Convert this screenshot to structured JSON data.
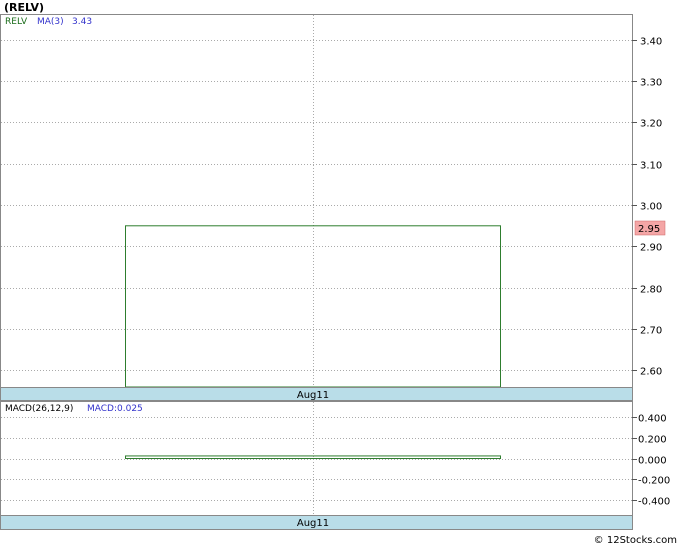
{
  "title": "(RELV)",
  "watermark": "© 12Stocks.com",
  "colors": {
    "price_line": "#2e7d2e",
    "ma_text": "#3333cc",
    "relv_text": "#1a6b1a",
    "band_fill": "#b9dde8",
    "grid": "#aaaaaa",
    "last_price_bg": "#f4a6a6"
  },
  "chart_data": [
    {
      "type": "bar",
      "panel": "price",
      "legend": {
        "symbol": "RELV",
        "ma_label": "MA(3)",
        "ma_value": "3.43"
      },
      "x_label": "Aug11",
      "ylim": [
        2.56,
        3.46
      ],
      "yticks": [
        "3.40",
        "3.30",
        "3.20",
        "3.10",
        "3.00",
        "2.90",
        "2.80",
        "2.70",
        "2.60"
      ],
      "ytick_values": [
        3.4,
        3.3,
        3.2,
        3.1,
        3.0,
        2.9,
        2.8,
        2.7,
        2.6
      ],
      "bars": [
        {
          "category": "Aug11",
          "value": 2.95
        }
      ],
      "last_price": "2.95",
      "grid": true
    },
    {
      "type": "bar",
      "panel": "macd",
      "legend": {
        "label": "MACD(26,12,9)",
        "value_label": "MACD:0.025"
      },
      "x_label": "Aug11",
      "ylim": [
        -0.55,
        0.55
      ],
      "yticks": [
        "0.400",
        "0.200",
        "0.000",
        "-0.200",
        "-0.400"
      ],
      "ytick_values": [
        0.4,
        0.2,
        0.0,
        -0.2,
        -0.4
      ],
      "bars": [
        {
          "category": "Aug11",
          "value": 0.025
        }
      ],
      "grid": true
    }
  ]
}
